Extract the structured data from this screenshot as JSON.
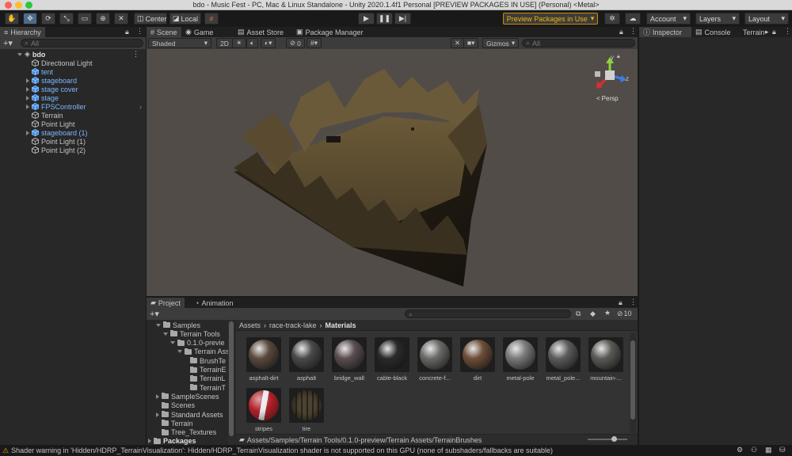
{
  "window": {
    "title": "bdo - Music Fest - PC, Mac & Linux Standalone - Unity 2020.1.4f1 Personal [PREVIEW PACKAGES IN USE] (Personal) <Metal>"
  },
  "toolbar": {
    "pivot_label": "Center",
    "space_label": "Local",
    "preview_packages_label": "Preview Packages in Use",
    "account_label": "Account",
    "layers_label": "Layers",
    "layout_label": "Layout"
  },
  "hierarchy": {
    "tab_label": "Hierarchy",
    "search_placeholder": "All",
    "scene_name": "bdo",
    "items": [
      {
        "label": "Directional Light",
        "prefab": false,
        "expandable": false
      },
      {
        "label": "tent",
        "prefab": true,
        "expandable": false
      },
      {
        "label": "stageboard",
        "prefab": true,
        "expandable": true
      },
      {
        "label": "stage cover",
        "prefab": true,
        "expandable": true
      },
      {
        "label": "stage",
        "prefab": true,
        "expandable": true
      },
      {
        "label": "FPSController",
        "prefab": true,
        "expandable": true
      },
      {
        "label": "Terrain",
        "prefab": false,
        "expandable": false
      },
      {
        "label": "Point Light",
        "prefab": false,
        "expandable": false
      },
      {
        "label": "stageboard (1)",
        "prefab": true,
        "expandable": true
      },
      {
        "label": "Point Light (1)",
        "prefab": false,
        "expandable": false
      },
      {
        "label": "Point Light (2)",
        "prefab": false,
        "expandable": false
      }
    ]
  },
  "scene_tabs": {
    "scene": "Scene",
    "game": "Game",
    "asset_store": "Asset Store",
    "package_manager": "Package Manager"
  },
  "scene_toolbar": {
    "shading_mode": "Shaded",
    "mode_2d": "2D",
    "hidden_count": "0",
    "gizmos_label": "Gizmos",
    "search_placeholder": "All",
    "persp_label": "Persp",
    "axis_y": "y",
    "axis_z": "z"
  },
  "inspector_tabs": {
    "inspector": "Inspector",
    "console": "Console",
    "terrain": "Terrain"
  },
  "project": {
    "tab_project": "Project",
    "tab_animation": "Animation",
    "hidden_count": "10",
    "tree": [
      {
        "label": "Samples",
        "depth": 0,
        "state": "open"
      },
      {
        "label": "Terrain Tools",
        "depth": 1,
        "state": "open"
      },
      {
        "label": "0.1.0-previe",
        "depth": 2,
        "state": "open"
      },
      {
        "label": "Terrain Ass",
        "depth": 3,
        "state": "open"
      },
      {
        "label": "BrushTe",
        "depth": 4,
        "state": "none"
      },
      {
        "label": "TerrainE",
        "depth": 4,
        "state": "none"
      },
      {
        "label": "TerrainL",
        "depth": 4,
        "state": "none"
      },
      {
        "label": "TerrainT",
        "depth": 4,
        "state": "none"
      },
      {
        "label": "SampleScenes",
        "depth": 0,
        "state": "closed"
      },
      {
        "label": "Scenes",
        "depth": 0,
        "state": "none"
      },
      {
        "label": "Standard Assets",
        "depth": 0,
        "state": "closed"
      },
      {
        "label": "Terrain",
        "depth": 0,
        "state": "none"
      },
      {
        "label": "Tree_Textures",
        "depth": 0,
        "state": "none"
      },
      {
        "label": "Packages",
        "depth": -1,
        "state": "closed"
      }
    ],
    "breadcrumb": [
      "Assets",
      "race-track-lake",
      "Materials"
    ],
    "materials": [
      {
        "label": "asphalt-dirt",
        "color": "#5a4a3e"
      },
      {
        "label": "asphalt",
        "color": "#4a4a4a"
      },
      {
        "label": "bridge_wall",
        "color": "#5a4e50"
      },
      {
        "label": "cable-black",
        "color": "#2a2a2a"
      },
      {
        "label": "concrete-f...",
        "color": "#6a6a68"
      },
      {
        "label": "dirt",
        "color": "#6e4e3a"
      },
      {
        "label": "metal-pole",
        "color": "#7a7a7a"
      },
      {
        "label": "metal_pole...",
        "color": "#5c5c5c"
      },
      {
        "label": "mountain-...",
        "color": "#5a5a56"
      },
      {
        "label": "stripes",
        "color": "#b0202a"
      },
      {
        "label": "tire",
        "color": "#4a4232"
      }
    ],
    "status_path": "Assets/Samples/Terrain Tools/0.1.0-preview/Terrain Assets/TerrainBrushes"
  },
  "status_bar": {
    "warning_text": "Shader warning in 'Hidden/HDRP_TerrainVisualization': Hidden/HDRP_TerrainVisualization shader is not supported on this GPU (none of subshaders/fallbacks are suitable)"
  },
  "colors": {
    "accent": "#4d6a8e",
    "warning": "#f0b400",
    "prefab_blue": "#7cb7ff"
  }
}
